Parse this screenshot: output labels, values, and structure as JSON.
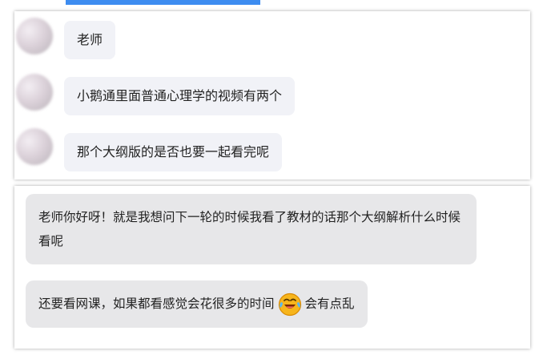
{
  "chat_top": {
    "messages": [
      {
        "text": "老师"
      },
      {
        "text": "小鹅通里面普通心理学的视频有两个"
      },
      {
        "text": "那个大纲版的是否也要一起看完呢"
      }
    ]
  },
  "chat_bottom": {
    "messages": [
      {
        "text": "老师你好呀！就是我想问下一轮的时候我看了教材的话那个大纲解析什么时候看呢"
      },
      {
        "text_before": "还要看网课，如果都看感觉会花很多的时间",
        "emoji": "laughing-tears-emoji",
        "text_after": "会有点乱"
      }
    ]
  },
  "colors": {
    "bubble_top": "#f1f2f7",
    "bubble_bottom": "#e7e7e9",
    "accent_strip": "#3d8cf0"
  }
}
